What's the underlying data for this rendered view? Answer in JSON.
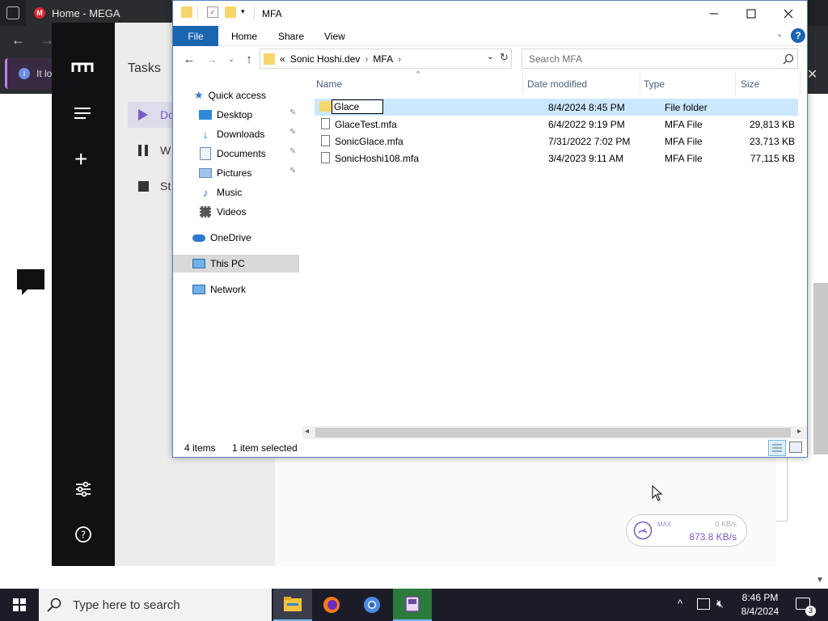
{
  "browser": {
    "tab_title": "Home - MEGA",
    "tab_close": "✕",
    "info_text": "It lo"
  },
  "mega": {
    "tasks_title": "Tasks",
    "nav": [
      {
        "label": "Do",
        "icon": "play-icon"
      },
      {
        "label": "W",
        "icon": "pause-icon"
      },
      {
        "label": "St",
        "icon": "stop-icon"
      }
    ],
    "speed": {
      "max_label": "MAX",
      "upload": "0 KB/s",
      "download": "873.8 KB/s"
    },
    "accent": "#7a5cc8"
  },
  "explorer": {
    "title": "MFA",
    "ribbon": {
      "file": "File",
      "home": "Home",
      "share": "Share",
      "view": "View",
      "help": "?"
    },
    "address": {
      "prefix": "«",
      "crumbs": [
        "Sonic Hoshi.dev",
        "MFA"
      ]
    },
    "search": {
      "placeholder": "Search MFA"
    },
    "nav_pane": [
      {
        "label": "Quick access",
        "icon": "star-icon",
        "indent": 0,
        "pinned": false
      },
      {
        "label": "Desktop",
        "icon": "desktop-icon",
        "indent": 1,
        "pinned": true
      },
      {
        "label": "Downloads",
        "icon": "download-icon",
        "indent": 1,
        "pinned": true
      },
      {
        "label": "Documents",
        "icon": "documents-icon",
        "indent": 1,
        "pinned": true
      },
      {
        "label": "Pictures",
        "icon": "pictures-icon",
        "indent": 1,
        "pinned": true
      },
      {
        "label": "Music",
        "icon": "music-icon",
        "indent": 1,
        "pinned": false
      },
      {
        "label": "Videos",
        "icon": "videos-icon",
        "indent": 1,
        "pinned": false
      },
      {
        "label": "OneDrive",
        "icon": "cloud-icon",
        "indent": 0,
        "pinned": false
      },
      {
        "label": "This PC",
        "icon": "computer-icon",
        "indent": 0,
        "pinned": false,
        "selected": true
      },
      {
        "label": "Network",
        "icon": "network-icon",
        "indent": 0,
        "pinned": false
      }
    ],
    "columns": {
      "name": "Name",
      "date": "Date modified",
      "type": "Type",
      "size": "Size"
    },
    "files": [
      {
        "name": "Glace",
        "date": "8/4/2024 8:45 PM",
        "type": "File folder",
        "size": "",
        "kind": "folder",
        "selected": true,
        "renaming": true
      },
      {
        "name": "GlaceTest.mfa",
        "date": "6/4/2022 9:19 PM",
        "type": "MFA File",
        "size": "29,813 KB",
        "kind": "file"
      },
      {
        "name": "SonicGlace.mfa",
        "date": "7/31/2022 7:02 PM",
        "type": "MFA File",
        "size": "23,713 KB",
        "kind": "file"
      },
      {
        "name": "SonicHoshi108.mfa",
        "date": "3/4/2023 9:11 AM",
        "type": "MFA File",
        "size": "77,115 KB",
        "kind": "file"
      }
    ],
    "status": {
      "items": "4 items",
      "selected": "1 item selected"
    }
  },
  "taskbar": {
    "search_placeholder": "Type here to search",
    "time": "8:46 PM",
    "date": "8/4/2024",
    "notifications": "3"
  }
}
